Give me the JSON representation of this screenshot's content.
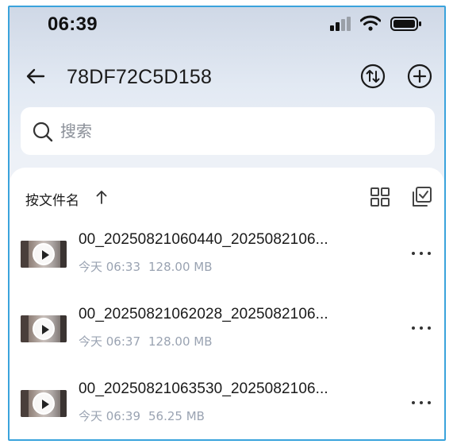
{
  "status_bar": {
    "time": "06:39",
    "icons": [
      "cellular-signal-icon",
      "wifi-icon",
      "battery-icon"
    ]
  },
  "header": {
    "title": "78DF72C5D158",
    "back_icon": "arrow-left-icon",
    "actions": [
      "transfer-icon",
      "add-circle-icon"
    ]
  },
  "search": {
    "placeholder": "搜索",
    "value": ""
  },
  "toolbar": {
    "sort_label": "按文件名",
    "sort_direction_icon": "arrow-up-icon",
    "view_icon": "grid-view-icon",
    "select_icon": "multi-select-icon"
  },
  "files": [
    {
      "name": "00_20250821060440_2025082106...",
      "date": "今天 06:33",
      "size": "128.00 MB"
    },
    {
      "name": "00_20250821062028_2025082106...",
      "date": "今天 06:37",
      "size": "128.00 MB"
    },
    {
      "name": "00_20250821063530_2025082106...",
      "date": "今天 06:39",
      "size": "56.25 MB"
    }
  ],
  "colors": {
    "accent_border": "#3aa3dc",
    "meta_text": "#9aa3b2",
    "background": "#eff2f6"
  }
}
